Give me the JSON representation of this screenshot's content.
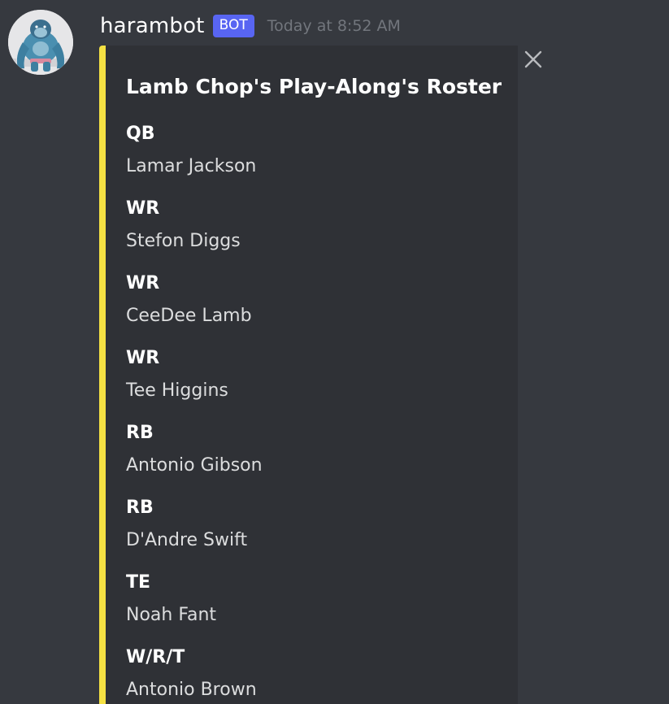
{
  "message": {
    "username": "harambot",
    "badge": "BOT",
    "timestamp": "Today at 8:52 AM",
    "avatar_icon": "gorilla-avatar",
    "embed": {
      "accent_color": "#f5e143",
      "title": "Lamb Chop's Play-Along's Roster",
      "close_icon": "close-icon",
      "fields": [
        {
          "name": "QB",
          "value": "Lamar Jackson"
        },
        {
          "name": "WR",
          "value": "Stefon Diggs"
        },
        {
          "name": "WR",
          "value": "CeeDee Lamb"
        },
        {
          "name": "WR",
          "value": "Tee Higgins"
        },
        {
          "name": "RB",
          "value": "Antonio Gibson"
        },
        {
          "name": "RB",
          "value": "D'Andre Swift"
        },
        {
          "name": "TE",
          "value": "Noah Fant"
        },
        {
          "name": "W/R/T",
          "value": "Antonio Brown"
        }
      ]
    }
  },
  "colors": {
    "background": "#36393f",
    "embed_background": "#2f3136",
    "badge": "#5865f2",
    "timestamp": "#72767d"
  }
}
